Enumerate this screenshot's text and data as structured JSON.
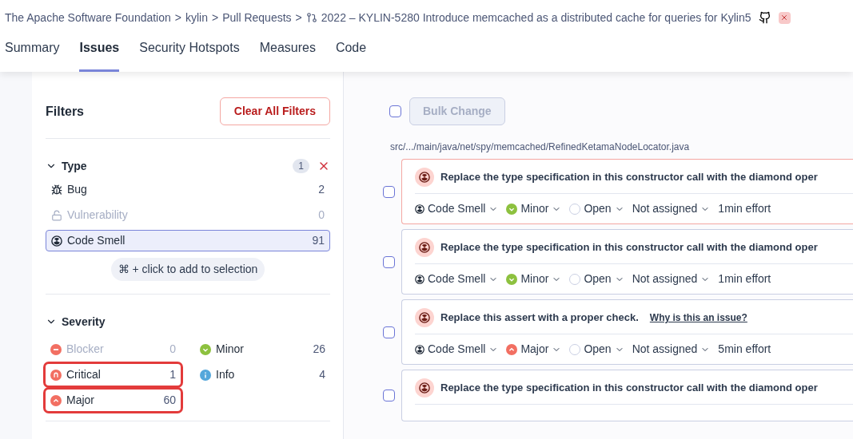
{
  "breadcrumb": [
    {
      "kind": "link",
      "text": "The Apache Software Foundation"
    },
    {
      "kind": "separator",
      "text": ">"
    },
    {
      "kind": "link",
      "text": "kylin"
    },
    {
      "kind": "separator",
      "text": ">"
    },
    {
      "kind": "link",
      "text": "Pull Requests"
    },
    {
      "kind": "separator",
      "text": ">"
    },
    {
      "kind": "pull_request",
      "text": "2022 – KYLIN-5280 Introduce memcached as a distributed cache for queries for Kylin5"
    }
  ],
  "tabs": [
    {
      "label": "Summary",
      "selected": false
    },
    {
      "label": "Issues",
      "selected": true
    },
    {
      "label": "Security Hotspots",
      "selected": false
    },
    {
      "label": "Measures",
      "selected": false
    },
    {
      "label": "Code",
      "selected": false
    }
  ],
  "filters": {
    "title": "Filters",
    "clear_button": "Clear All Filters",
    "type": {
      "title": "Type",
      "expanded": true,
      "badge": "1",
      "items": [
        {
          "kind": "bug",
          "label": "Bug",
          "count": "2",
          "selected": false,
          "disabled": false
        },
        {
          "kind": "vulnerability",
          "label": "Vulnerability",
          "count": "0",
          "selected": false,
          "disabled": true
        },
        {
          "kind": "code_smell",
          "label": "Code Smell",
          "count": "91",
          "selected": true,
          "disabled": false
        }
      ],
      "hint": "⌘ + click to add to selection"
    },
    "severity": {
      "title": "Severity",
      "expanded": true,
      "items": [
        {
          "kind": "blocker",
          "label": "Blocker",
          "count": "0",
          "disabled": true,
          "highlighted": false
        },
        {
          "kind": "minor",
          "label": "Minor",
          "count": "26",
          "disabled": false,
          "highlighted": false
        },
        {
          "kind": "critical",
          "label": "Critical",
          "count": "1",
          "disabled": false,
          "highlighted": true
        },
        {
          "kind": "info",
          "label": "Info",
          "count": "4",
          "disabled": false,
          "highlighted": false
        },
        {
          "kind": "major",
          "label": "Major",
          "count": "60",
          "disabled": false,
          "highlighted": true
        }
      ]
    }
  },
  "select_all_checked": false,
  "bulk_change": "Bulk Change",
  "file_path": "src/.../main/java/net/spy/memcached/RefinedKetamaNodeLocator.java",
  "issues": [
    {
      "message": "Replace the type specification in this constructor call with the diamond oper",
      "selected": true,
      "checked": false,
      "type": "Code Smell",
      "severity": {
        "kind": "minor",
        "label": "Minor"
      },
      "status": "Open",
      "assignee": "Not assigned",
      "effort": "1min effort"
    },
    {
      "message": "Replace the type specification in this constructor call with the diamond oper",
      "selected": false,
      "checked": false,
      "type": "Code Smell",
      "severity": {
        "kind": "minor",
        "label": "Minor"
      },
      "status": "Open",
      "assignee": "Not assigned",
      "effort": "1min effort"
    },
    {
      "message": "Replace this assert with a proper check.",
      "link": "Why is this an issue?",
      "selected": false,
      "checked": false,
      "type": "Code Smell",
      "severity": {
        "kind": "major",
        "label": "Major"
      },
      "status": "Open",
      "assignee": "Not assigned",
      "effort": "5min effort"
    },
    {
      "message": "Replace the type specification in this constructor call with the diamond oper",
      "selected": false,
      "checked": false
    }
  ]
}
